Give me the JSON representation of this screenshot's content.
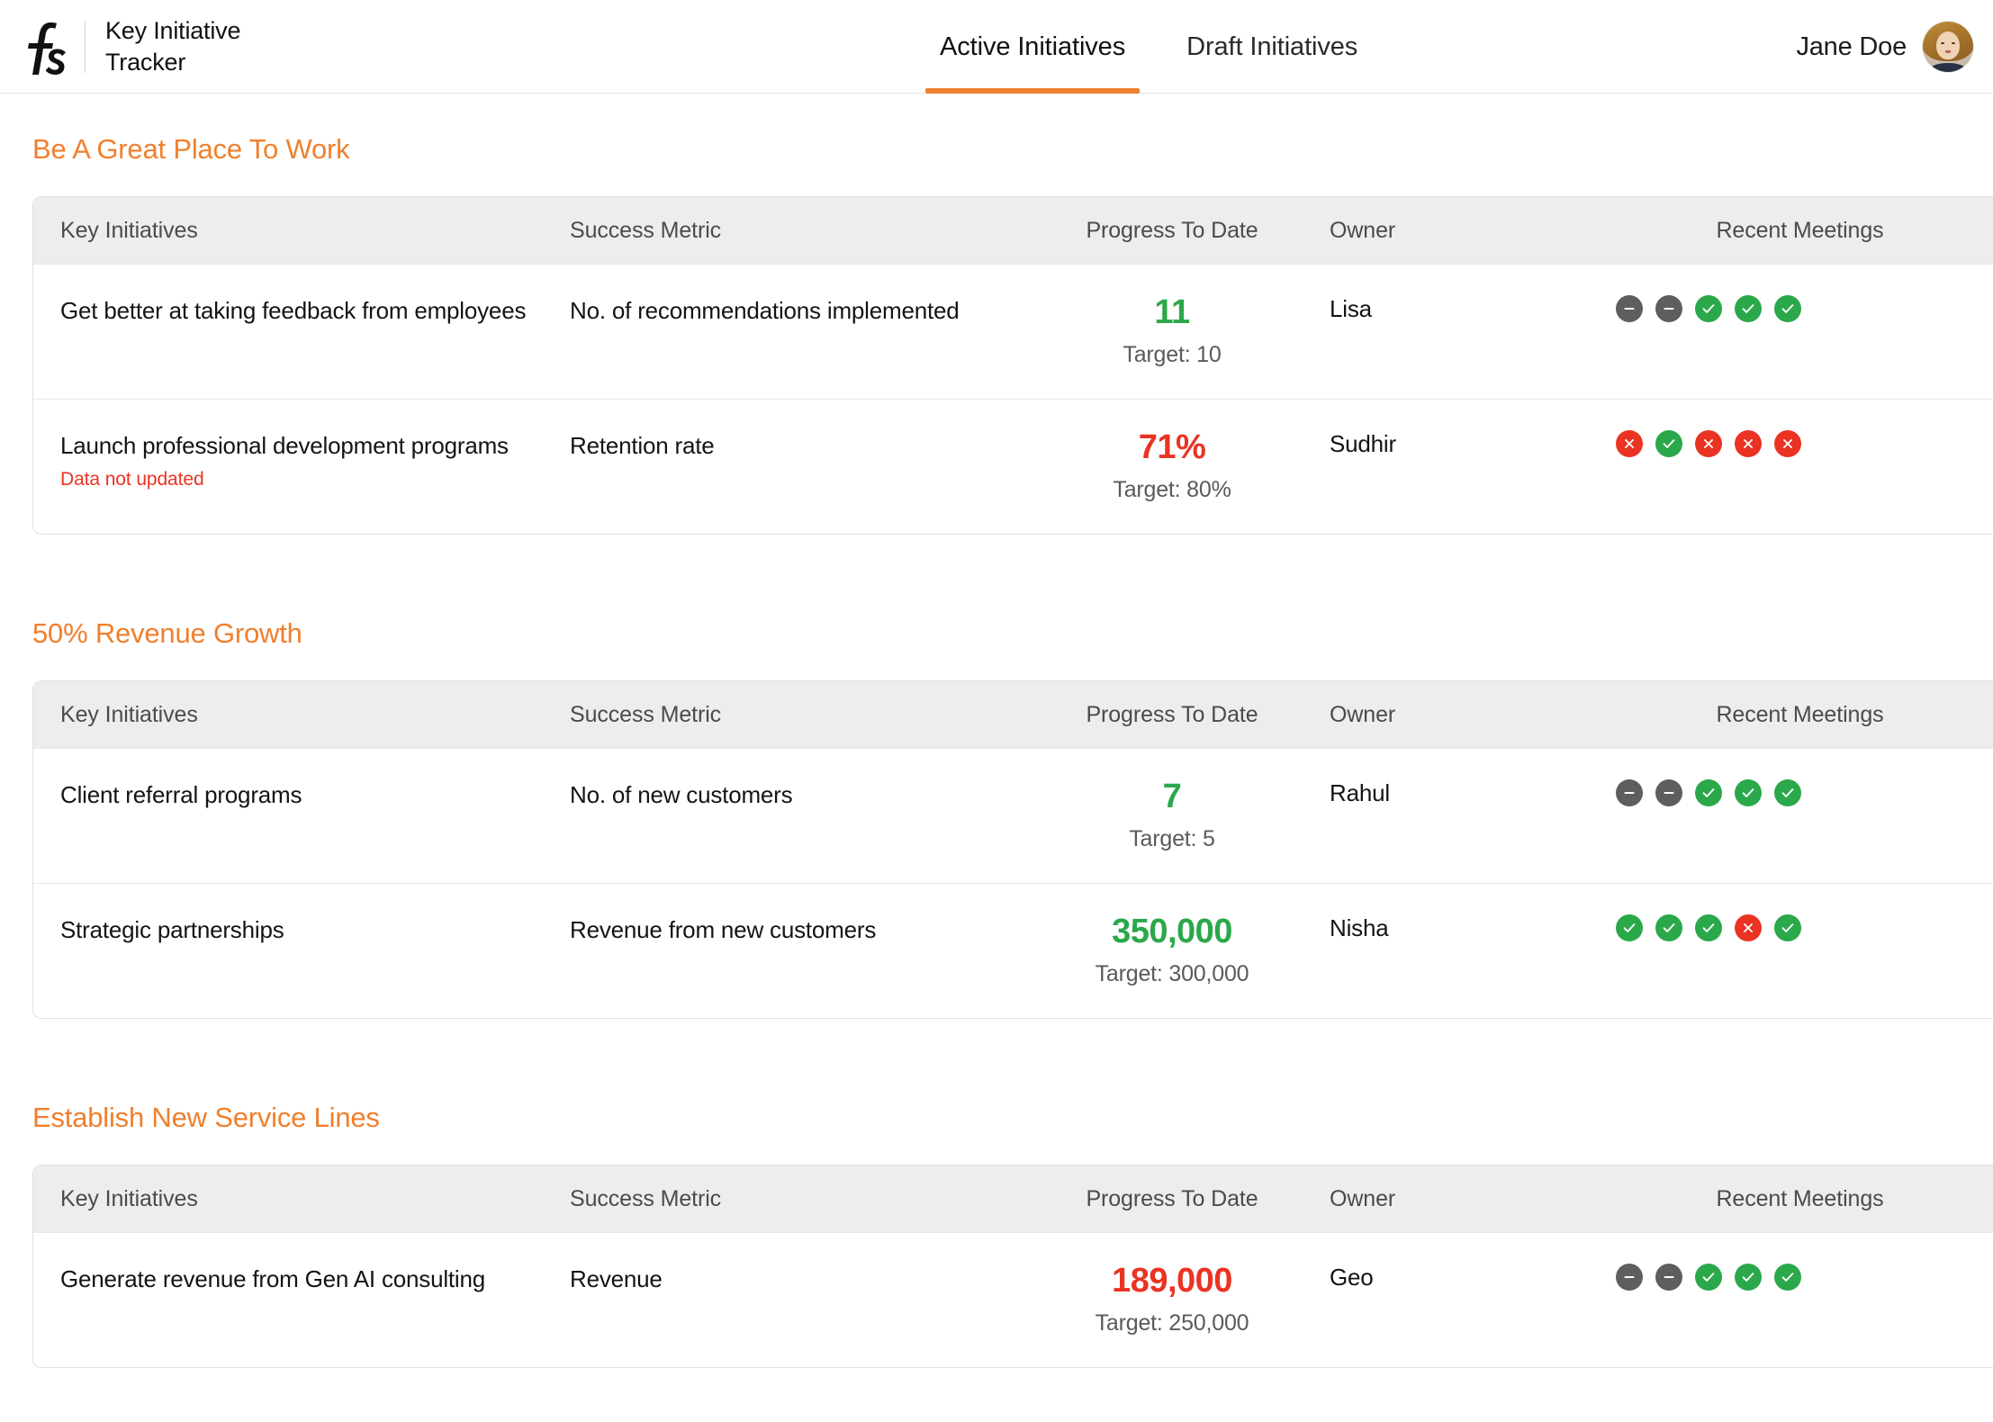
{
  "header": {
    "logo_icon": "fs-monogram-logo",
    "brand_title": "Key Initiative\nTracker",
    "tabs": [
      {
        "label": "Active Initiatives",
        "active": true
      },
      {
        "label": "Draft Initiatives",
        "active": false
      }
    ],
    "user": {
      "name": "Jane Doe",
      "avatar_icon": "user-avatar-photo"
    }
  },
  "theme": {
    "accent": "#f07f2d",
    "good": "#2ba84a",
    "bad": "#ea3323",
    "neutral": "#5e5e5e",
    "header_row_bg": "#ededed"
  },
  "columns": [
    "Key Initiatives",
    "Success Metric",
    "Progress To Date",
    "Owner",
    "Recent Meetings"
  ],
  "sections": [
    {
      "title": "Be A Great Place To Work",
      "rows": [
        {
          "initiative": "Get better at taking feedback from employees",
          "warning": "",
          "metric": "No. of recommendations implemented",
          "progress_value": "11",
          "progress_status": "good",
          "target": "Target: 10",
          "owner": "Lisa",
          "meetings": [
            "none",
            "none",
            "ok",
            "ok",
            "ok"
          ]
        },
        {
          "initiative": "Launch professional development programs",
          "warning": "Data not updated",
          "metric": "Retention rate",
          "progress_value": "71%",
          "progress_status": "bad",
          "target": "Target: 80%",
          "owner": "Sudhir",
          "meetings": [
            "fail",
            "ok",
            "fail",
            "fail",
            "fail"
          ]
        }
      ]
    },
    {
      "title": "50% Revenue Growth",
      "rows": [
        {
          "initiative": "Client referral programs",
          "warning": "",
          "metric": "No. of new customers",
          "progress_value": "7",
          "progress_status": "good",
          "target": "Target: 5",
          "owner": "Rahul",
          "meetings": [
            "none",
            "none",
            "ok",
            "ok",
            "ok"
          ]
        },
        {
          "initiative": "Strategic partnerships",
          "warning": "",
          "metric": "Revenue from new customers",
          "progress_value": "350,000",
          "progress_status": "good",
          "target": "Target: 300,000",
          "owner": "Nisha",
          "meetings": [
            "ok",
            "ok",
            "ok",
            "fail",
            "ok"
          ]
        }
      ]
    },
    {
      "title": "Establish New Service Lines",
      "rows": [
        {
          "initiative": "Generate revenue from Gen AI consulting",
          "warning": "",
          "metric": "Revenue",
          "progress_value": "189,000",
          "progress_status": "bad",
          "target": "Target: 250,000",
          "owner": "Geo",
          "meetings": [
            "none",
            "none",
            "ok",
            "ok",
            "ok"
          ]
        }
      ]
    }
  ]
}
